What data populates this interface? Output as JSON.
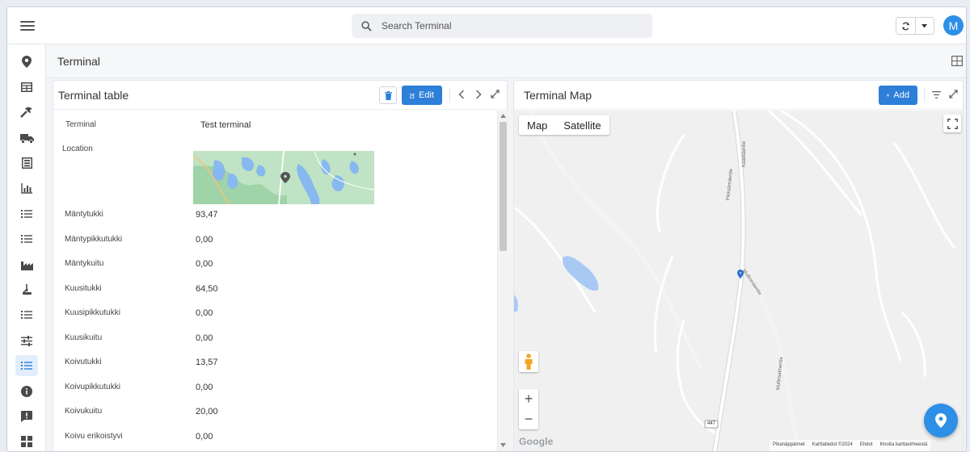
{
  "search": {
    "placeholder": "Search Terminal"
  },
  "user": {
    "avatar_letter": "M"
  },
  "page": {
    "title": "Terminal"
  },
  "colors": {
    "accent": "#2d7fd8",
    "avatar": "#2d8fe6",
    "map_water": "#a9c9f5"
  },
  "sidebar": {
    "items": [
      {
        "icon": "location-pin-icon"
      },
      {
        "icon": "table-icon"
      },
      {
        "icon": "tools-icon"
      },
      {
        "icon": "truck-icon"
      },
      {
        "icon": "form-icon"
      },
      {
        "icon": "chart-icon"
      },
      {
        "icon": "list-icon"
      },
      {
        "icon": "list-icon"
      },
      {
        "icon": "factory-icon"
      },
      {
        "icon": "forest-machine-icon"
      },
      {
        "icon": "list-icon"
      },
      {
        "icon": "sliders-icon"
      },
      {
        "icon": "list-icon",
        "active": true
      },
      {
        "icon": "info-icon"
      },
      {
        "icon": "feedback-icon"
      },
      {
        "icon": "apps-grid-icon"
      }
    ]
  },
  "table_panel": {
    "title": "Terminal table",
    "edit_label": "Edit",
    "terminal_label": "Terminal",
    "terminal_value": "Test terminal",
    "location_label": "Location",
    "rows": [
      {
        "label": "Mäntytukki",
        "value": "93,47"
      },
      {
        "label": "Mäntypikkutukki",
        "value": "0,00"
      },
      {
        "label": "Mäntykuitu",
        "value": "0,00"
      },
      {
        "label": "Kuusitukki",
        "value": "64,50"
      },
      {
        "label": "Kuusipikkutukki",
        "value": "0,00"
      },
      {
        "label": "Kuusikuitu",
        "value": "0,00"
      },
      {
        "label": "Koivutukki",
        "value": "13,57"
      },
      {
        "label": "Koivupikkutukki",
        "value": "0,00"
      },
      {
        "label": "Koivukuitu",
        "value": "20,00"
      },
      {
        "label": "Koivu erikoistyvi",
        "value": "0,00"
      }
    ]
  },
  "map_panel": {
    "title": "Terminal Map",
    "add_label": "Add",
    "map_type": {
      "map": "Map",
      "satellite": "Satellite"
    },
    "road_labels": [
      "Pieksämäentie",
      "Kääntäentie",
      "Mullinmäentie",
      "Mullinsalmentie",
      "447"
    ],
    "google_logo": "Google",
    "attribution": [
      "Pikanäppäimet",
      "Karttatiedot ©2024",
      "Ehdot",
      "Ilmoita karttavirheestä"
    ]
  }
}
